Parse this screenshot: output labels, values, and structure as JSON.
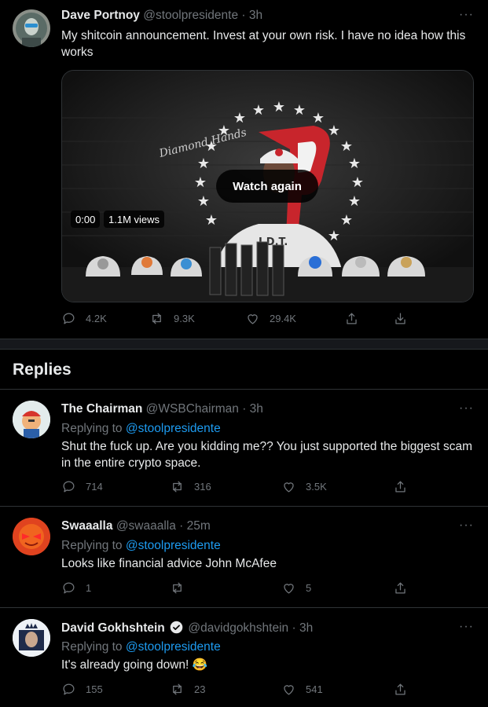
{
  "main_tweet": {
    "name": "Dave Portnoy",
    "handle": "@stoolpresidente · 3h",
    "more": "···",
    "text": "My shitcoin announcement.   Invest at your own risk.    I have no idea how this works",
    "media": {
      "overlay_button": "Watch again",
      "time": "0:00",
      "views": "1.1M views",
      "sign_text": "Diamond Hands",
      "shirt_text": "J.D.T."
    },
    "stats": {
      "replies": "4.2K",
      "retweets": "9.3K",
      "likes": "29.4K"
    }
  },
  "replies_header": "Replies",
  "replies": [
    {
      "name": "The Chairman",
      "handle": "@WSBChairman · 3h",
      "replying_prefix": "Replying to ",
      "replying_to": "@stoolpresidente",
      "text": "Shut the fuck up. Are you kidding me?? You just supported the biggest scam in the entire crypto space.",
      "stats": {
        "replies": "714",
        "retweets": "316",
        "likes": "3.5K"
      }
    },
    {
      "name": "Swaaalla",
      "handle": "@swaaalla · 25m",
      "replying_prefix": "Replying to ",
      "replying_to": "@stoolpresidente",
      "text": "Looks like financial advice John McAfee",
      "stats": {
        "replies": "1",
        "retweets": "",
        "likes": "5"
      }
    },
    {
      "name": "David Gokhshtein",
      "handle": "@davidgokhshtein · 3h",
      "replying_prefix": "Replying to ",
      "replying_to": "@stoolpresidente",
      "text": "It's already going down! 😂",
      "stats": {
        "replies": "155",
        "retweets": "23",
        "likes": "541"
      }
    }
  ],
  "colors": {
    "accent": "#1d9bf0",
    "muted": "#71767b",
    "background": "#000000"
  }
}
